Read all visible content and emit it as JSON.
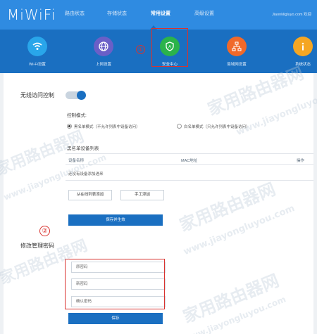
{
  "header": {
    "logo": "MiWiFi",
    "nav": [
      "路由状态",
      "存储状态",
      "常用设置",
      "高级设置"
    ],
    "active_nav": "常用设置",
    "account": "Jiaonkligluyo.com 欢迎"
  },
  "icon_tiles": [
    {
      "label": "Wi-Fi设置",
      "icon": "wifi-icon",
      "color": "#29a6ea"
    },
    {
      "label": "上网设置",
      "icon": "globe-icon",
      "color": "#6a5fc7"
    },
    {
      "label": "安全中心",
      "icon": "shield-icon",
      "color": "#2bb34b",
      "active": true
    },
    {
      "label": "局域网设置",
      "icon": "network-icon",
      "color": "#f0692a"
    },
    {
      "label": "系统状态",
      "icon": "info-icon",
      "color": "#f5a623"
    }
  ],
  "annotations": {
    "marker1": "①",
    "marker2": "②"
  },
  "wireless_control": {
    "title": "无线访问控制",
    "toggle_on": true,
    "mode_label": "控制模式:",
    "mode_blacklist": "黑名单模式（不允许列表中设备访问）",
    "mode_whitelist": "白名单模式（只允许列表中设备访问）",
    "selected_mode": "blacklist",
    "list_title": "黑名单设备列表",
    "columns": [
      "设备名称",
      "MAC地址",
      "操作"
    ],
    "empty_text": "还没有设备添加进来",
    "add_from_list": "从在线列表添加",
    "add_manual": "手工添加",
    "save": "保存并生效"
  },
  "admin_password": {
    "title": "修改管理密码",
    "old_placeholder": "原密码",
    "new_placeholder": "新密码",
    "confirm_placeholder": "确认密码",
    "save": "保存"
  },
  "watermark": {
    "cn": "家用路由器网",
    "url": "www.jiayongluyou.com"
  }
}
